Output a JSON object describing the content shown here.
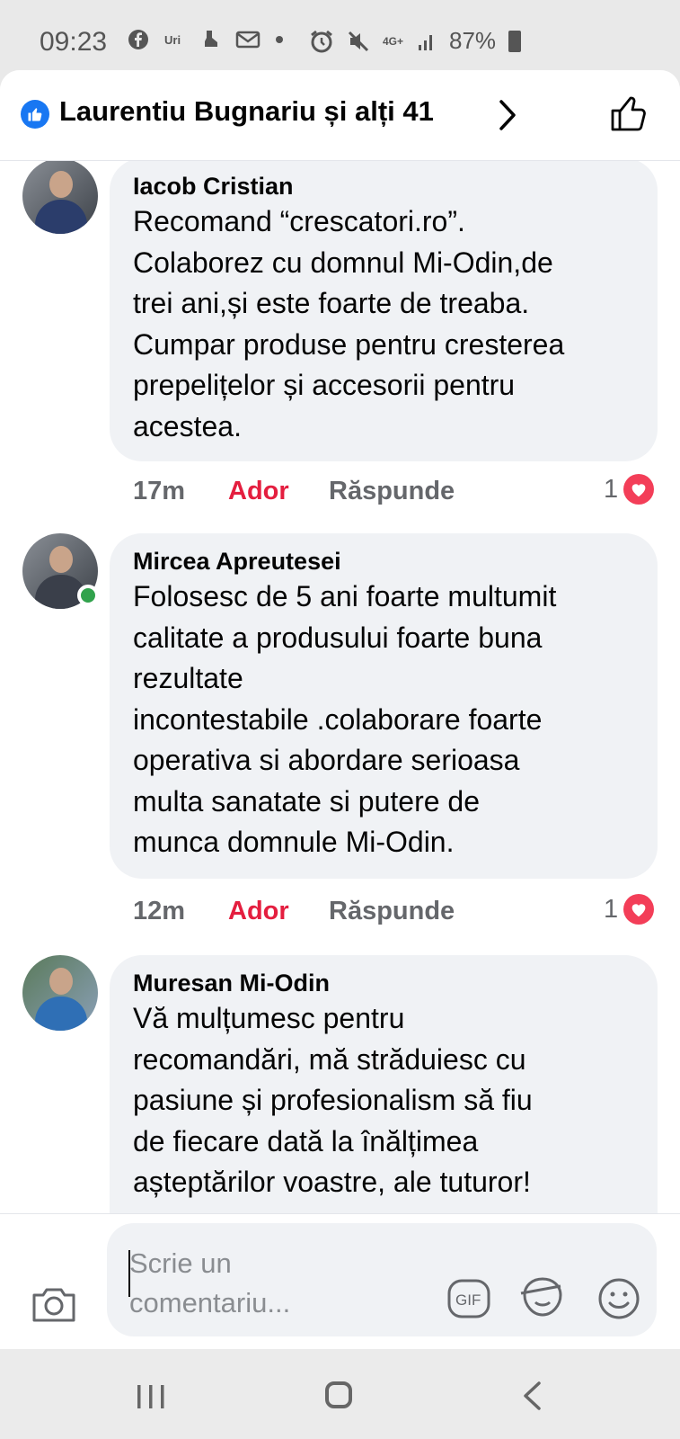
{
  "status_bar": {
    "time": "09:23",
    "network": "4G+",
    "battery": "87%",
    "icons": [
      "facebook-icon",
      "uniq-icon",
      "shoe-icon",
      "mail-icon",
      "dot-icon",
      "alarm-icon",
      "mute-icon",
      "signal-icon",
      "battery-icon"
    ]
  },
  "header": {
    "title": "Laurentiu Bugnariu și alți 41",
    "accent": "#1877f2"
  },
  "comments": [
    {
      "author": "Iacob Cristian",
      "text": "Recomand “crescatori.ro”.\nColaborez cu domnul Mi-Odin,de\ntrei ani,și este foarte de treaba.\nCumpar produse pentru cresterea\nprepelițelor și accesorii pentru\nacestea.",
      "time": "17m",
      "like_label": "Ador",
      "reply_label": "Răspunde",
      "reaction_count": "1",
      "online": false
    },
    {
      "author": "Mircea Apreutesei",
      "text": "Folosesc de 5 ani foarte multumit\ncalitate a produsului foarte buna\nrezultate\nincontestabile .colaborare foarte\noperativa si abordare serioasa\nmulta sanatate si putere de\nmunca domnule Mi-Odin.",
      "time": "12m",
      "like_label": "Ador",
      "reply_label": "Răspunde",
      "reaction_count": "1",
      "online": true
    },
    {
      "author": "Muresan Mi-Odin",
      "text": "Vă mulțumesc pentru\nrecomandări, mă străduiesc cu\npasiune și profesionalism să fiu\nde fiecare dată la înălțimea\nașteptărilor voastre, ale tuturor!",
      "time": "",
      "like_label": "",
      "reply_label": "",
      "reaction_count": "",
      "online": false
    }
  ],
  "composer": {
    "placeholder": "Scrie un comentariu..."
  },
  "colors": {
    "love": "#e41e3f",
    "heart_badge": "#f33e58",
    "bubble": "#f0f2f5",
    "online": "#31a24c"
  }
}
